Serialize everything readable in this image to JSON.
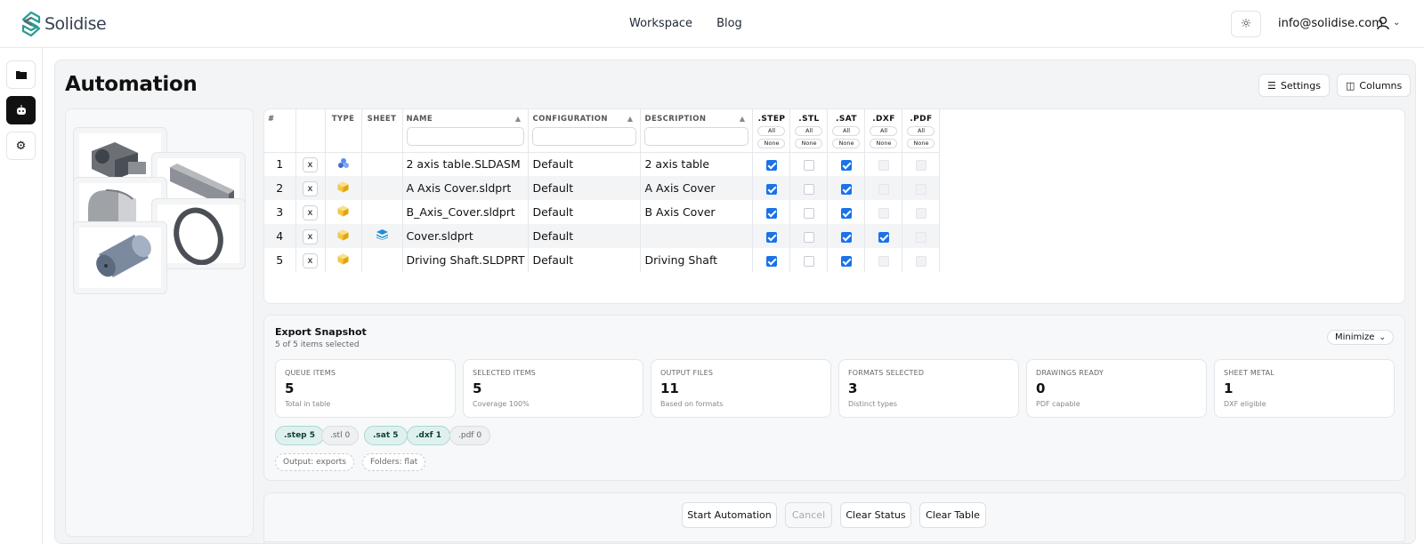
{
  "brand": {
    "name": "Solidise"
  },
  "nav": {
    "items": [
      "Workspace",
      "Blog"
    ]
  },
  "user": {
    "email": "info@solidise.com"
  },
  "page": {
    "title": "Automation"
  },
  "header_buttons": {
    "settings": "Settings",
    "columns": "Columns"
  },
  "table": {
    "headers": {
      "index": "#",
      "remove": "",
      "type": "TYPE",
      "sheet": "SHEET",
      "name": "NAME",
      "configuration": "CONFIGURATION",
      "description": "DESCRIPTION"
    },
    "formats": [
      ".STEP",
      ".STL",
      ".SAT",
      ".DXF",
      ".PDF"
    ],
    "format_buttons": {
      "all": "All",
      "none": "None"
    },
    "remove_label": "x",
    "rows": [
      {
        "index": "1",
        "type": "assembly-icon",
        "sheet": "",
        "name": "2 axis table.SLDASM",
        "configuration": "Default",
        "description": "2 axis table",
        "formats": [
          "on",
          "off",
          "on",
          "dis",
          "dis"
        ]
      },
      {
        "index": "2",
        "type": "part-icon",
        "sheet": "",
        "name": "A Axis Cover.sldprt",
        "configuration": "Default",
        "description": "A Axis Cover",
        "formats": [
          "on",
          "off",
          "on",
          "dis",
          "dis"
        ]
      },
      {
        "index": "3",
        "type": "part-icon",
        "sheet": "",
        "name": "B_Axis_Cover.sldprt",
        "configuration": "Default",
        "description": "B Axis Cover",
        "formats": [
          "on",
          "off",
          "on",
          "dis",
          "dis"
        ]
      },
      {
        "index": "4",
        "type": "part-icon",
        "sheet": "sheet-metal-icon",
        "name": "Cover.sldprt",
        "configuration": "Default",
        "description": "",
        "formats": [
          "on",
          "off",
          "on",
          "on",
          "dis"
        ]
      },
      {
        "index": "5",
        "type": "part-icon",
        "sheet": "",
        "name": "Driving Shaft.SLDPRT",
        "configuration": "Default",
        "description": "Driving Shaft",
        "formats": [
          "on",
          "off",
          "on",
          "dis",
          "dis"
        ]
      }
    ]
  },
  "snapshot": {
    "title": "Export Snapshot",
    "subtitle": "5 of 5 items selected",
    "minimize": "Minimize",
    "stats": [
      {
        "label": "QUEUE ITEMS",
        "value": "5",
        "note": "Total in table"
      },
      {
        "label": "SELECTED ITEMS",
        "value": "5",
        "note": "Coverage 100%"
      },
      {
        "label": "OUTPUT FILES",
        "value": "11",
        "note": "Based on formats"
      },
      {
        "label": "FORMATS SELECTED",
        "value": "3",
        "note": "Distinct types"
      },
      {
        "label": "DRAWINGS READY",
        "value": "0",
        "note": "PDF capable"
      },
      {
        "label": "SHEET METAL",
        "value": "1",
        "note": "DXF eligible"
      }
    ],
    "chips": [
      {
        "label": ".step 5",
        "active": true
      },
      {
        "label": ".stl 0",
        "active": false
      },
      {
        "label": ".sat 5",
        "active": true
      },
      {
        "label": ".dxf 1",
        "active": true
      },
      {
        "label": ".pdf 0",
        "active": false
      }
    ],
    "tags": [
      "Output: exports",
      "Folders: flat"
    ]
  },
  "actions": {
    "start": "Start Automation",
    "cancel": "Cancel",
    "clear_status": "Clear Status",
    "clear_table": "Clear Table"
  },
  "colors": {
    "accent": "#1a73e8",
    "chip_active_bg": "#dff1ef",
    "brand_teal": "#2a9d8f"
  }
}
